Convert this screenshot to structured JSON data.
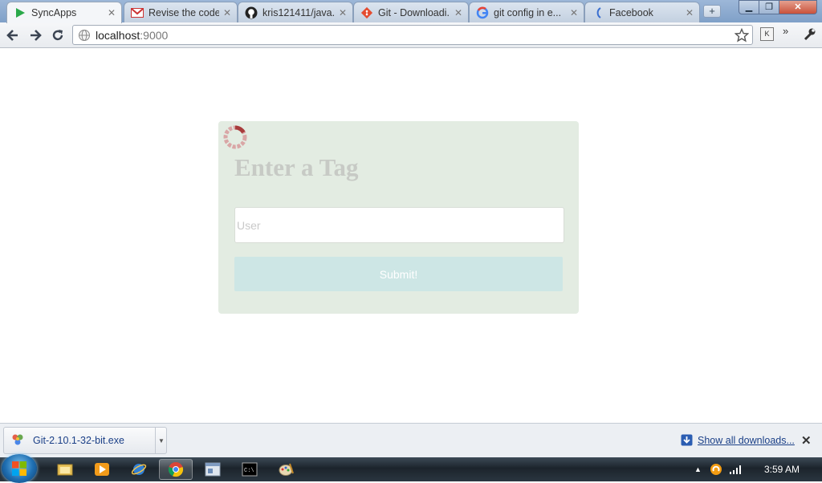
{
  "browser": {
    "tabs": [
      {
        "title": "SyncApps",
        "icon": "play-icon",
        "active": true
      },
      {
        "title": "Revise the code...",
        "icon": "gmail-icon",
        "active": false
      },
      {
        "title": "kris121411/java...",
        "icon": "github-icon",
        "active": false
      },
      {
        "title": "Git - Downloadi...",
        "icon": "git-icon",
        "active": false
      },
      {
        "title": "git config in e...",
        "icon": "google-icon",
        "active": false
      },
      {
        "title": "Facebook",
        "icon": "loading-icon",
        "active": false
      }
    ],
    "url_host": "localhost",
    "url_port": ":9000",
    "extension_label": "K"
  },
  "page": {
    "title": "Enter a Tag",
    "input_placeholder": "User",
    "input_value": "",
    "submit_label": "Submit!"
  },
  "downloads": {
    "item_name": "Git-2.10.1-32-bit.exe",
    "show_all_label": "Show all downloads..."
  },
  "taskbar": {
    "clock": "3:59 AM",
    "apps": [
      "explorer-icon",
      "media-player-icon",
      "ie-icon",
      "chrome-icon",
      "window-icon",
      "cmd-icon",
      "paint-icon"
    ]
  },
  "colors": {
    "card_background": "#e3ece2",
    "submit_background": "#cde6e5",
    "title_color": "#c7cac5",
    "spinner_color": "#a83c3c"
  }
}
